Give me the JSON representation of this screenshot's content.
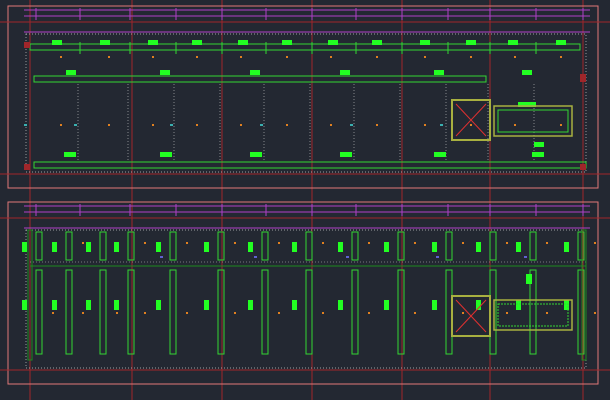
{
  "drawing": {
    "background": "#232832",
    "colors": {
      "outline": "#e07878",
      "axis": "#a0262a",
      "wall": "#33d633",
      "wall_dark": "#1e8a1e",
      "label_fill": "#22ff22",
      "magenta": "#b040c8",
      "dotted": "#c8c8c8",
      "orange": "#e08020",
      "cyan": "#3ab0b0",
      "blue": "#6060d0",
      "olive": "#a8b040",
      "void_x": "#e03030"
    },
    "plans": [
      {
        "id": "upper-plan",
        "variant": "beams"
      },
      {
        "id": "lower-plan",
        "variant": "columns"
      }
    ],
    "bay_count": 12,
    "icons": {
      "void": "void-cross-icon"
    }
  }
}
